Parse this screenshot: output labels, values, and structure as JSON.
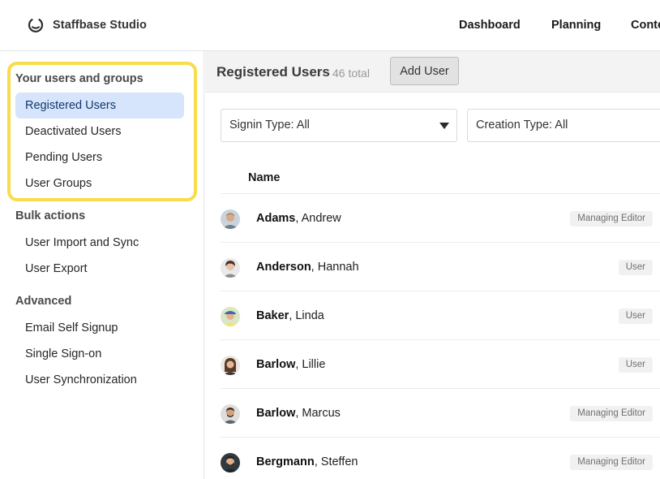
{
  "app": {
    "name": "Staffbase Studio",
    "logo_icon": "staffbase-logo-icon"
  },
  "topnav": [
    {
      "label": "Dashboard"
    },
    {
      "label": "Planning"
    },
    {
      "label": "Conte"
    }
  ],
  "sidebar": {
    "section_users": "Your users and groups",
    "users_items": [
      {
        "label": "Registered Users",
        "active": true
      },
      {
        "label": "Deactivated Users"
      },
      {
        "label": "Pending Users"
      },
      {
        "label": "User Groups"
      }
    ],
    "section_bulk": "Bulk actions",
    "bulk_items": [
      {
        "label": "User Import and Sync"
      },
      {
        "label": "User Export"
      }
    ],
    "section_advanced": "Advanced",
    "advanced_items": [
      {
        "label": "Email Self Signup"
      },
      {
        "label": "Single Sign-on"
      },
      {
        "label": "User Synchronization"
      }
    ],
    "highlight_color": "#f8dc4a",
    "active_color": "#d6e5fb"
  },
  "main": {
    "title": "Registered Users",
    "total": "46 total",
    "add_button": "Add User",
    "filters": {
      "signin": "Signin Type: All",
      "creation": "Creation Type: All"
    },
    "table": {
      "name_header": "Name",
      "rows": [
        {
          "last": "Adams",
          "first": ", Andrew",
          "role": "Managing Editor",
          "avatar_icon": "user-avatar-icon"
        },
        {
          "last": "Anderson",
          "first": ", Hannah",
          "role": "User",
          "avatar_icon": "user-avatar-icon"
        },
        {
          "last": "Baker",
          "first": ", Linda",
          "role": "User",
          "avatar_icon": "user-avatar-icon"
        },
        {
          "last": "Barlow",
          "first": ", Lillie",
          "role": "User",
          "avatar_icon": "user-avatar-icon"
        },
        {
          "last": "Barlow",
          "first": ", Marcus",
          "role": "Managing Editor",
          "avatar_icon": "user-avatar-icon"
        },
        {
          "last": "Bergmann",
          "first": ", Steffen",
          "role": "Managing Editor",
          "avatar_icon": "user-avatar-icon"
        }
      ]
    }
  }
}
